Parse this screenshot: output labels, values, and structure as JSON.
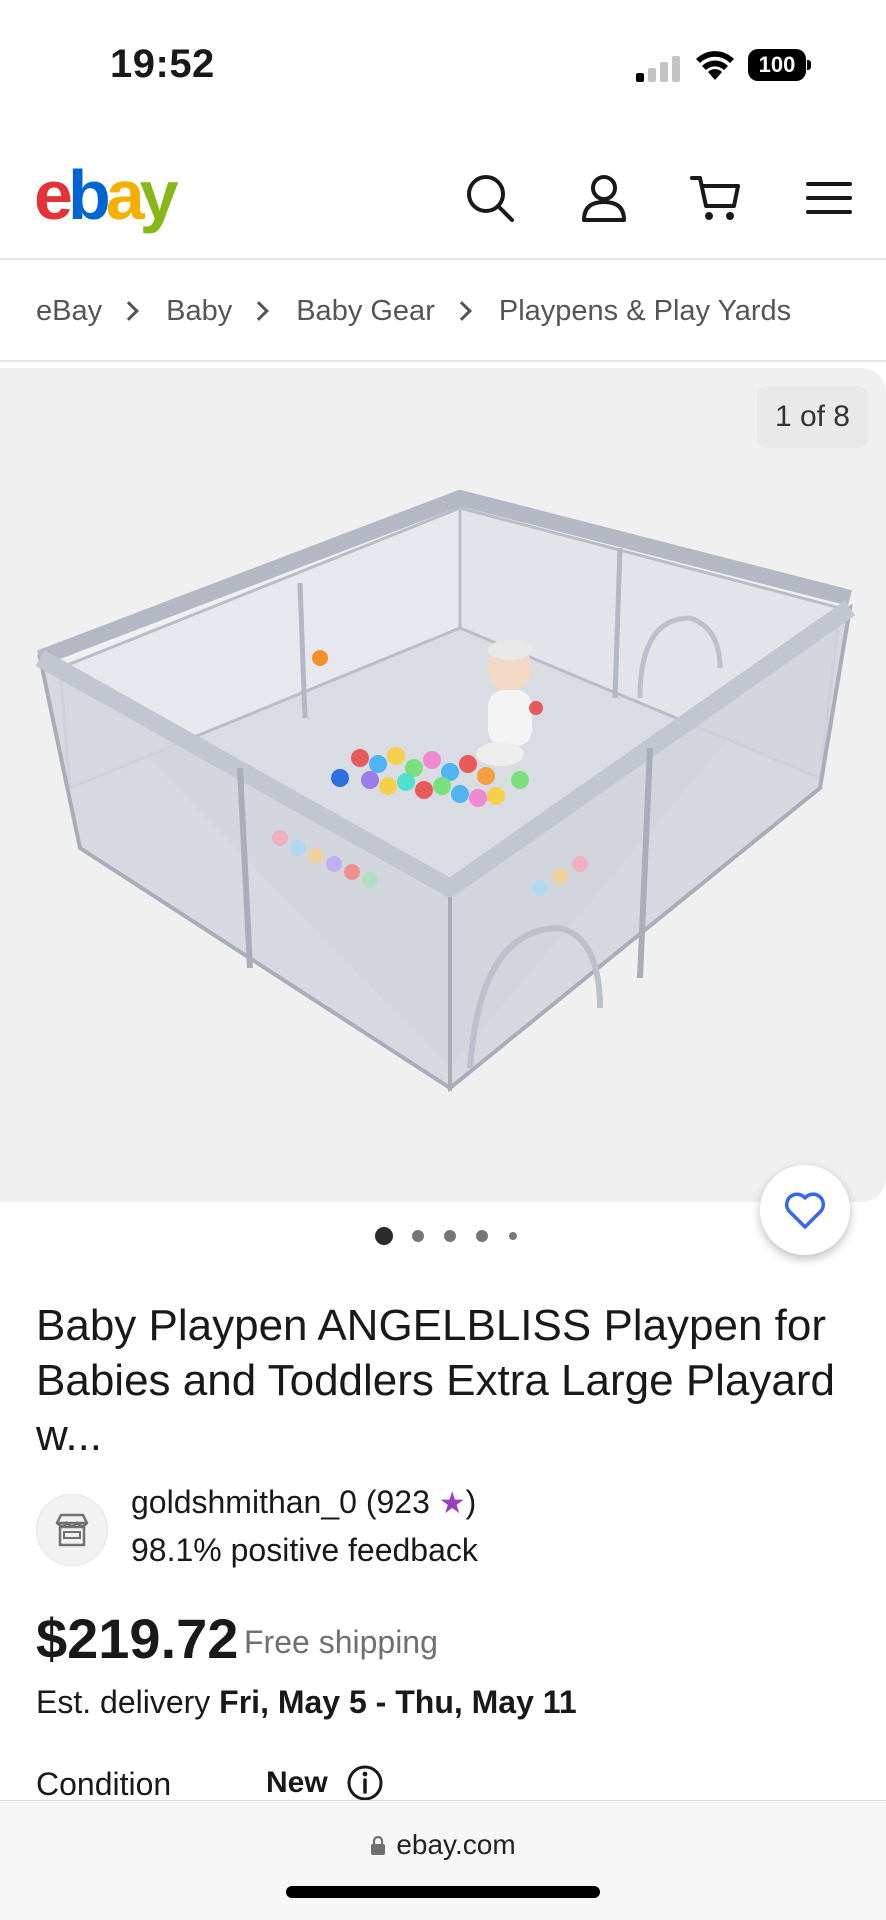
{
  "status_bar": {
    "time": "19:52",
    "battery": "100"
  },
  "header": {
    "logo_letters": [
      "e",
      "b",
      "a",
      "y"
    ],
    "icons": [
      "search-icon",
      "account-icon",
      "cart-icon",
      "menu-icon"
    ]
  },
  "breadcrumb": [
    "eBay",
    "Baby",
    "Baby Gear",
    "Playpens & Play Yards"
  ],
  "gallery": {
    "counter": "1 of 8",
    "dots": 5,
    "active_dot": 0
  },
  "product": {
    "title": "Baby Playpen ANGELBLISS Playpen for Babies and Toddlers Extra Large Playard w...",
    "seller_name": "goldshmithan_0 (923",
    "seller_star": "★",
    "seller_name_close": ")",
    "seller_feedback": "98.1% positive feedback",
    "price": "$219.72",
    "shipping": "Free shipping",
    "delivery_prefix": "Est. delivery ",
    "delivery_dates": "Fri, May 5 - Thu, May 11",
    "condition_label": "Condition",
    "condition_value": "New"
  },
  "url_bar": {
    "domain": "ebay.com"
  },
  "colors": {
    "accent": "#3665f3",
    "star": "#9b3fbf"
  }
}
